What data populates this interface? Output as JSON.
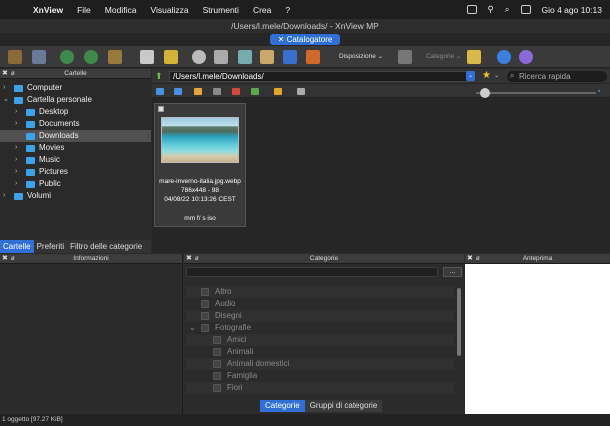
{
  "menubar": {
    "app": "XnView",
    "items": [
      "File",
      "Modifica",
      "Visualizza",
      "Strumenti",
      "Crea",
      "?"
    ],
    "datetime": "Gio 4 ago  10:13"
  },
  "window": {
    "title": "/Users/l.mele/Downloads/ - XnView MP"
  },
  "tab": {
    "label": "Catalogatore"
  },
  "toolbar": {
    "layout_label": "Disposizione",
    "categories_label": "Categorie"
  },
  "folders_panel": {
    "title": "Cartelle",
    "tree": [
      {
        "label": "Computer",
        "level": 0,
        "expanded": false
      },
      {
        "label": "Cartella personale",
        "level": 0,
        "expanded": true
      },
      {
        "label": "Desktop",
        "level": 1,
        "expanded": false
      },
      {
        "label": "Documents",
        "level": 1,
        "expanded": false
      },
      {
        "label": "Downloads",
        "level": 1,
        "selected": true
      },
      {
        "label": "Movies",
        "level": 1,
        "expanded": false
      },
      {
        "label": "Music",
        "level": 1,
        "expanded": false
      },
      {
        "label": "Pictures",
        "level": 1,
        "expanded": false
      },
      {
        "label": "Public",
        "level": 1,
        "expanded": false
      },
      {
        "label": "Volumi",
        "level": 0,
        "expanded": false
      }
    ],
    "tabs": [
      "Cartelle",
      "Preferiti",
      "Filtro delle categorie"
    ]
  },
  "browser": {
    "path": "/Users/l.mele/Downloads/",
    "search_placeholder": "Ricerca rapida",
    "thumbnail": {
      "filename": "mare-inverno-italia.jpg.webp",
      "dims": "786x448 - 98",
      "date": "04/08/22 10:13:26 CEST",
      "extra": "mm f/ s iso"
    }
  },
  "info_panel": {
    "title": "Informazioni"
  },
  "categories_panel": {
    "title": "Categorie",
    "button": "...",
    "items": [
      {
        "label": "Altro",
        "level": 0
      },
      {
        "label": "Audio",
        "level": 0
      },
      {
        "label": "Disegni",
        "level": 0
      },
      {
        "label": "Fotografie",
        "level": 0,
        "expanded": true
      },
      {
        "label": "Amici",
        "level": 1
      },
      {
        "label": "Animali",
        "level": 1
      },
      {
        "label": "Animali domestici",
        "level": 1
      },
      {
        "label": "Famiglia",
        "level": 1
      },
      {
        "label": "Fiori",
        "level": 1
      }
    ],
    "tabs": [
      "Categorie",
      "Gruppi di categorie"
    ]
  },
  "preview_panel": {
    "title": "Anteprima"
  },
  "status": {
    "text": "1 oggetto [97.27 KiB]"
  },
  "colors": {
    "accent": "#2f6fd6",
    "folder": "#3ea2e8"
  }
}
